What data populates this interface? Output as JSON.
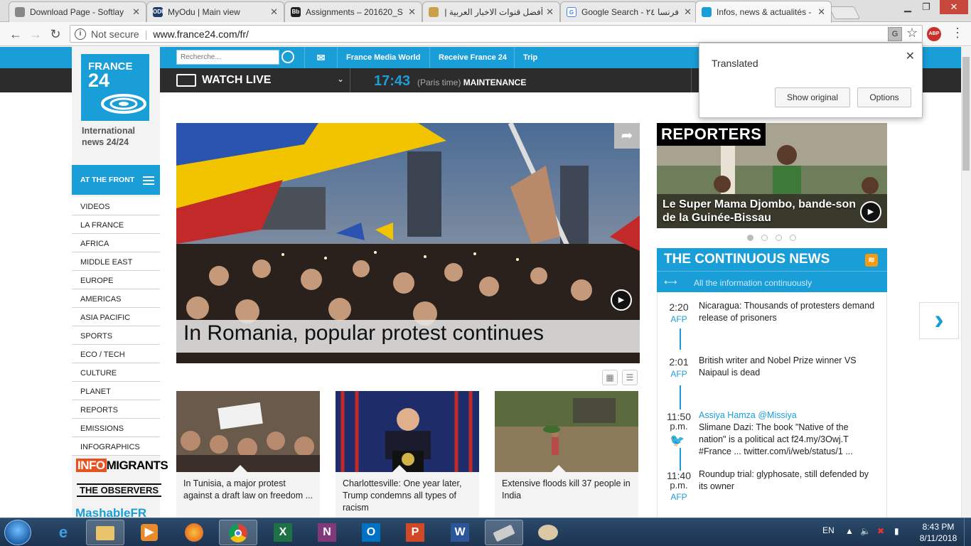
{
  "tabs": [
    {
      "title": "Download Page - Softlay",
      "icon": "doc-icon",
      "color": "#666"
    },
    {
      "title": "MyOdu | Main view",
      "icon": "odu-icon",
      "color": "#1e3c6e"
    },
    {
      "title": "Assignments – 201620_S",
      "icon": "blackboard-icon",
      "color": "#222"
    },
    {
      "title": "أفضل قنوات الاخبار العربية | الم",
      "icon": "site-icon",
      "color": "#c8a24a"
    },
    {
      "title": "Google Search - فرنسا ٢٤",
      "icon": "google-icon",
      "color": "#4285f4"
    },
    {
      "title": "Infos, news & actualités -",
      "icon": "france24-icon",
      "color": "#1a9ed8"
    }
  ],
  "omnibox": {
    "security": "Not secure",
    "url": "www.france24.com/fr/"
  },
  "translate_popup": {
    "title": "Translated",
    "show_original": "Show original",
    "options": "Options"
  },
  "topbar": {
    "search_placeholder": "Recherche...",
    "links": [
      "France Media World",
      "Receive France 24",
      "Trip"
    ]
  },
  "live": {
    "watch_live": "WATCH LIVE",
    "time": "17:43",
    "time_note": "(Paris time)",
    "program": "MAINTENANCE"
  },
  "logo": {
    "line1": "FRANCE",
    "line2": "24",
    "tagline": "International news 24/24"
  },
  "nav": {
    "header": "AT THE FRONT",
    "items": [
      "VIDEOS",
      "LA FRANCE",
      "AFRICA",
      "MIDDLE EAST",
      "EUROPE",
      "AMERICAS",
      "ASIA PACIFIC",
      "SPORTS",
      "ECO / TECH",
      "CULTURE",
      "PLANET",
      "REPORTS",
      "EMISSIONS",
      "INFOGRAPHICS"
    ],
    "infomigrants_a": "INFO",
    "infomigrants_b": "MIGRANTS",
    "observers": "THE OBSERVERS",
    "mashable": "MashableFR"
  },
  "hero": {
    "headline": "In Romania, popular protest continues"
  },
  "cards": [
    {
      "caption": "In Tunisia, a major protest against a draft law on freedom ..."
    },
    {
      "caption": "Charlottesville: One year later, Trump condemns all types of racism"
    },
    {
      "caption": "Extensive floods kill 37 people in India"
    }
  ],
  "reporters": {
    "logo": "REPORTERS",
    "title": "Le Super Mama Djombo, bande-son de la Guinée-Bissau"
  },
  "continuous": {
    "title": "THE CONTINUOUS NEWS",
    "subtitle": "All the information continuously",
    "items": [
      {
        "time": "2:20",
        "source": "AFP",
        "text": "Nicaragua: Thousands of protesters demand release of prisoners"
      },
      {
        "time": "2:01",
        "source": "AFP",
        "text": "British writer and Nobel Prize winner VS Naipaul is dead"
      },
      {
        "time": "11:50",
        "ampm": "p.m.",
        "author": "Assiya Hamza @Missiya",
        "text": "Slimane Dazi: The book \"Native of the nation\" is a political act f24.my/3Owj.T #France ... twitter.com/i/web/status/1 ..."
      },
      {
        "time": "11:40",
        "ampm": "p.m.",
        "source": "AFP",
        "text": "Roundup trial: glyphosate, still defended by its owner"
      }
    ]
  },
  "taskbar": {
    "apps": [
      "ie-icon",
      "explorer-icon",
      "media-icon",
      "firefox-icon",
      "chrome-icon",
      "excel-icon",
      "onenote-icon",
      "outlook-icon",
      "powerpoint-icon",
      "word-icon",
      "usb-icon",
      "paint-icon"
    ],
    "lang": "EN",
    "time": "8:43 PM",
    "date": "8/11/2018"
  },
  "colors": {
    "accent": "#1a9ed8",
    "dark": "#2c2c2c"
  }
}
